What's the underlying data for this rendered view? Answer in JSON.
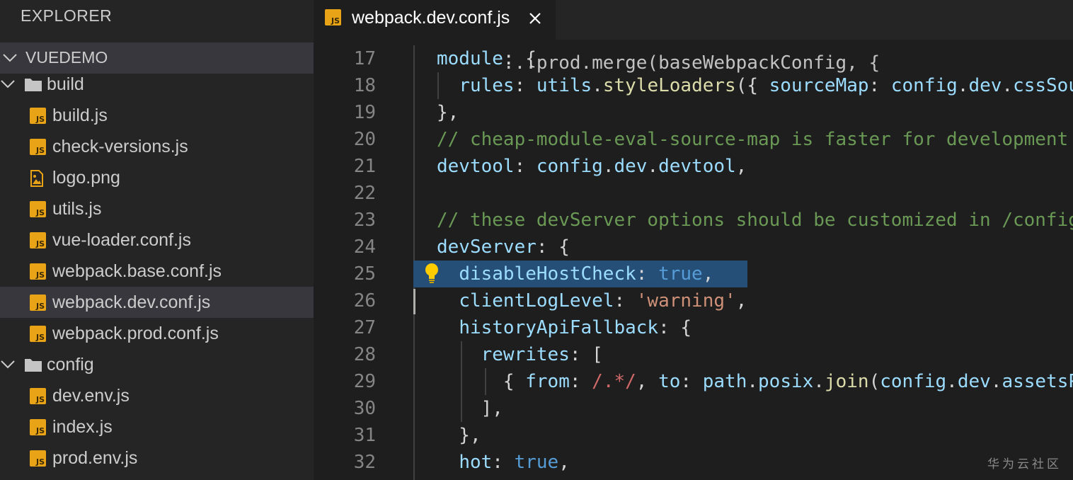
{
  "sidebar": {
    "title": "EXPLORER",
    "project": "VUEDEMO",
    "items": [
      {
        "type": "folder",
        "label": "build"
      },
      {
        "type": "file",
        "icon": "js",
        "label": "build.js"
      },
      {
        "type": "file",
        "icon": "js",
        "label": "check-versions.js"
      },
      {
        "type": "file",
        "icon": "image",
        "label": "logo.png"
      },
      {
        "type": "file",
        "icon": "js",
        "label": "utils.js"
      },
      {
        "type": "file",
        "icon": "js",
        "label": "vue-loader.conf.js"
      },
      {
        "type": "file",
        "icon": "js",
        "label": "webpack.base.conf.js"
      },
      {
        "type": "file",
        "icon": "js",
        "label": "webpack.dev.conf.js",
        "selected": true
      },
      {
        "type": "file",
        "icon": "js",
        "label": "webpack.prod.conf.js"
      },
      {
        "type": "folder",
        "label": "config"
      },
      {
        "type": "file",
        "icon": "js",
        "label": "dev.env.js"
      },
      {
        "type": "file",
        "icon": "js",
        "label": "index.js"
      },
      {
        "type": "file",
        "icon": "js",
        "label": "prod.env.js"
      }
    ]
  },
  "tab": {
    "label": "webpack.dev.conf.js",
    "icon_text": "JS",
    "close_icon": "close-icon"
  },
  "editor": {
    "top_partial": "  ...prod.merge(baseWebpackConfig, {",
    "lines": [
      {
        "n": "17",
        "text": "module: {"
      },
      {
        "n": "18",
        "text": "  rules: utils.styleLoaders({ sourceMap: config.dev.cssSourceMap, usePostCSS: true })"
      },
      {
        "n": "19",
        "text": "},"
      },
      {
        "n": "20",
        "text": "// cheap-module-eval-source-map is faster for development"
      },
      {
        "n": "21",
        "text": "devtool: config.dev.devtool,"
      },
      {
        "n": "22",
        "text": ""
      },
      {
        "n": "23",
        "text": "// these devServer options should be customized in /config/index.js"
      },
      {
        "n": "24",
        "text": "devServer: {"
      },
      {
        "n": "25",
        "text": "  disableHostCheck: true,"
      },
      {
        "n": "26",
        "text": "  clientLogLevel: 'warning',"
      },
      {
        "n": "27",
        "text": "  historyApiFallback: {"
      },
      {
        "n": "28",
        "text": "    rewrites: ["
      },
      {
        "n": "29",
        "text": "      { from: /.*/, to: path.posix.join(config.dev.assetsPublicPath, 'index.html') },"
      },
      {
        "n": "30",
        "text": "    ],"
      },
      {
        "n": "31",
        "text": "  },"
      },
      {
        "n": "32",
        "text": "  hot: true,"
      }
    ],
    "selected_line": "25",
    "lightbulb_icon": "lightbulb-icon"
  },
  "watermark": "华为云社区",
  "colors": {
    "sidebar_bg": "#252526",
    "editor_bg": "#1e1e1e",
    "selection": "#264f78",
    "js_icon": "#e8a317"
  }
}
